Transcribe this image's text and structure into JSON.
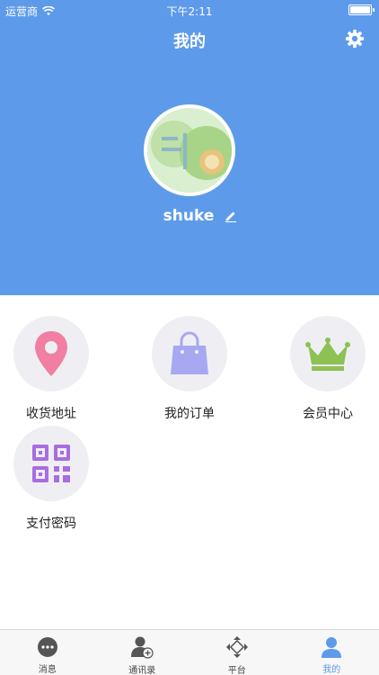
{
  "status_bar": {
    "carrier": "运营商",
    "time": "下午2:11"
  },
  "header": {
    "title": "我的",
    "username": "shuke"
  },
  "menu": [
    {
      "label": "收货地址",
      "icon": "location-pin-icon",
      "color": "#f07fa3"
    },
    {
      "label": "我的订单",
      "icon": "shopping-bag-icon",
      "color": "#a8a8f2"
    },
    {
      "label": "会员中心",
      "icon": "crown-icon",
      "color": "#8dc153"
    },
    {
      "label": "支付密码",
      "icon": "qr-code-icon",
      "color": "#a86de0"
    }
  ],
  "tabbar": {
    "tabs": [
      {
        "label": "消息",
        "icon": "chat-bubble-icon"
      },
      {
        "label": "通讯录",
        "icon": "add-contact-icon"
      },
      {
        "label": "平台",
        "icon": "platform-diamond-icon"
      },
      {
        "label": "我的",
        "icon": "person-icon",
        "active": true
      }
    ]
  },
  "colors": {
    "header_bg": "#5d9bea",
    "active_tab": "#5d9bea"
  }
}
